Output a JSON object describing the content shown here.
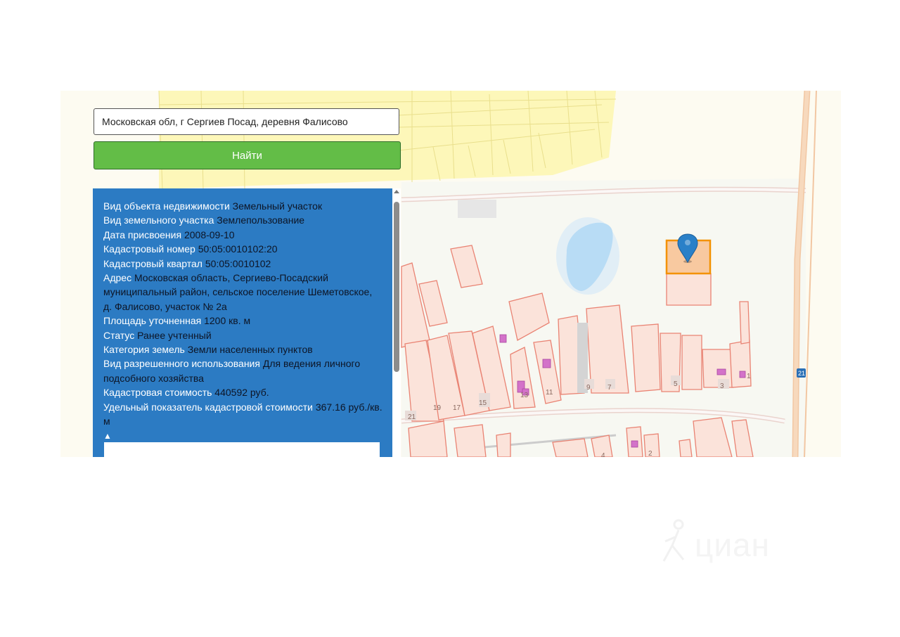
{
  "search": {
    "value": "Московская обл, г Сергиев Посад, деревня Фалисово",
    "button_label": "Найти"
  },
  "info": {
    "rows": [
      {
        "label": "Вид объекта недвижимости",
        "value": "Земельный участок"
      },
      {
        "label": "Вид земельного участка",
        "value": "Землепользование"
      },
      {
        "label": "Дата присвоения",
        "value": "2008-09-10"
      },
      {
        "label": "Кадастровый номер",
        "value": "50:05:0010102:20"
      },
      {
        "label": "Кадастровый квартал",
        "value": "50:05:0010102"
      },
      {
        "label": "Адрес",
        "value": "Московская область, Сергиево-Посадский муниципальный район, сельское поселение Шеметовское, д. Фалисово, участок № 2а"
      },
      {
        "label": "Площадь уточненная",
        "value": "1200 кв. м"
      },
      {
        "label": "Статус",
        "value": "Ранее учтенный"
      },
      {
        "label": "Категория земель",
        "value": "Земли населенных пунктов"
      },
      {
        "label": "Вид разрешенного использования",
        "value": "Для ведения личного подсобного хозяйства"
      },
      {
        "label": "Кадастровая стоимость",
        "value": "440592 руб."
      },
      {
        "label": "Удельный показатель кадастровой стоимости",
        "value": "367.16 руб./кв. м"
      }
    ],
    "collapse_symbol": "▲"
  },
  "map": {
    "plot_labels": {
      "p21": "21",
      "p19": "19",
      "p17": "17",
      "p15": "15",
      "p13": "13",
      "p11": "11",
      "p9": "9",
      "p7": "7",
      "p5": "5",
      "p3": "3",
      "p1": "1",
      "p4": "4",
      "p2": "2"
    },
    "road_badge": "21",
    "colors": {
      "parcel_fill": "#fbe3da",
      "parcel_stroke": "#e98373",
      "selected_stroke": "#f39200",
      "water": "#b8dcf5",
      "building": "#d372c9",
      "marker": "#2a80c8"
    }
  },
  "watermark": {
    "text": "циан",
    "icon": "cian-person-icon"
  }
}
